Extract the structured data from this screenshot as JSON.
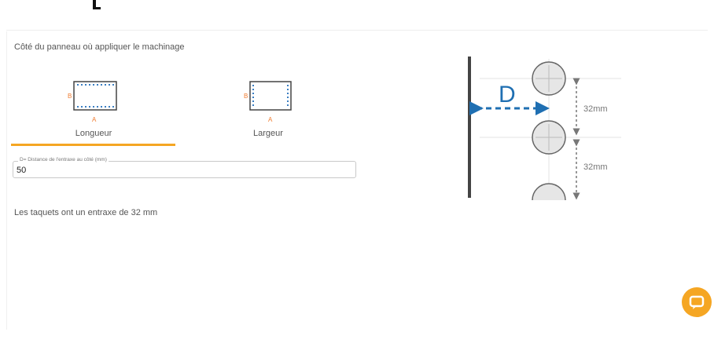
{
  "section_title": "Côté du panneau où appliquer le machinage",
  "tabs": [
    {
      "label": "Longueur",
      "side_a": "A",
      "side_b": "B",
      "selected": true
    },
    {
      "label": "Largeur",
      "side_a": "A",
      "side_b": "B",
      "selected": false
    }
  ],
  "distance_field": {
    "legend": "D= Distance de l'entraxe au côté (mm)",
    "value": "50"
  },
  "info_text": "Les taquets ont un entraxe de 32 mm",
  "diagram": {
    "letter": "D",
    "spacing_top": "32mm",
    "spacing_bottom": "32mm"
  },
  "colors": {
    "accent": "#f5a623",
    "diagram_blue": "#1f6fb2",
    "side_letter": "#f07b2f",
    "holes": "#3a7ec2"
  },
  "chat": {
    "icon": "chat-bubble-icon"
  }
}
